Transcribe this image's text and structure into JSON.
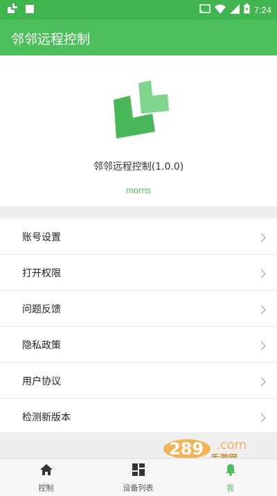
{
  "status_bar": {
    "time": "7:24",
    "left_icons": [
      "app-notification-icon",
      "square-notification-icon"
    ],
    "right_icons": [
      "cast-icon",
      "wifi-icon",
      "signal-icon",
      "battery-icon"
    ]
  },
  "app_bar": {
    "title": "邻邻远程控制"
  },
  "profile": {
    "app_name": "邻邻远程控制(1.0.0)",
    "username": "morris"
  },
  "menu": {
    "items": [
      {
        "label": "账号设置"
      },
      {
        "label": "打开权限"
      },
      {
        "label": "问题反馈"
      },
      {
        "label": "隐私政策"
      },
      {
        "label": "用户协议"
      },
      {
        "label": "检测新版本"
      }
    ]
  },
  "bottom_nav": {
    "tabs": [
      {
        "label": "控制",
        "icon": "home-icon"
      },
      {
        "label": "设备列表",
        "icon": "grid-icon"
      },
      {
        "label": "我",
        "icon": "bell-icon",
        "active": true
      }
    ]
  },
  "watermark": {
    "text": "手游网"
  },
  "colors": {
    "brand_green": "#4cbf5c",
    "status_green": "#3fb44f",
    "background": "#efefef"
  }
}
